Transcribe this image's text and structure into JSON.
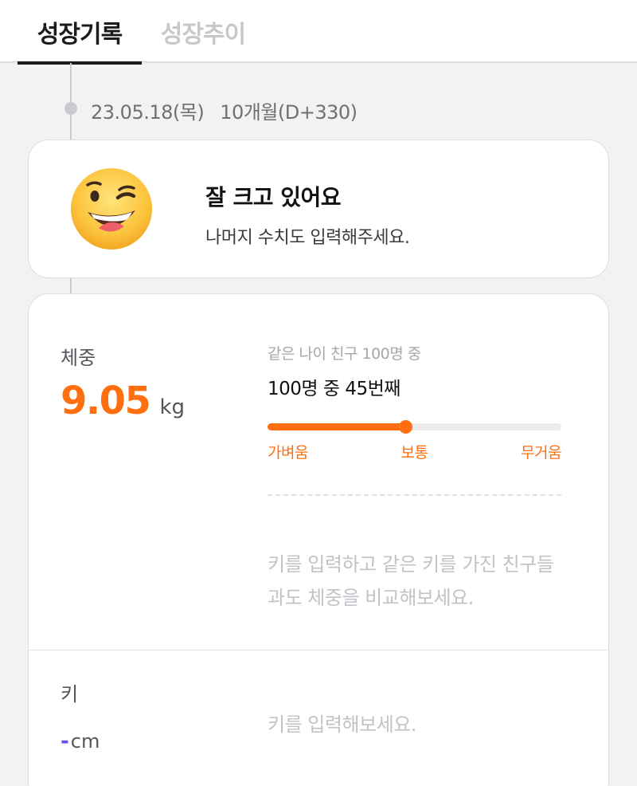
{
  "tabs": [
    {
      "label": "성장기록",
      "active": true
    },
    {
      "label": "성장추이",
      "active": false
    }
  ],
  "record": {
    "date": "23.05.18(목)",
    "age": "10개월(D+330)"
  },
  "status": {
    "icon": "winking-smile-emoji-icon",
    "title": "잘 크고 있어요",
    "subtitle": "나머지 수치도 입력해주세요."
  },
  "weight": {
    "label": "체중",
    "value": "9.05",
    "unit": "kg",
    "peer_caption": "같은 나이 친구 100명 중",
    "peer_rank": "100명 중 45번째",
    "position_percent": 47,
    "scale_labels": [
      "가벼움",
      "보통",
      "무거움"
    ],
    "compare_hint": "키를 입력하고 같은 키를 가진 친구들과도 체중을 비교해보세요."
  },
  "height": {
    "label": "키",
    "value": "-",
    "unit": "cm",
    "hint": "키를 입력해보세요."
  },
  "colors": {
    "accent": "#ff6f0f",
    "height_accent": "#6a52e8",
    "background": "#f2f2f3"
  }
}
